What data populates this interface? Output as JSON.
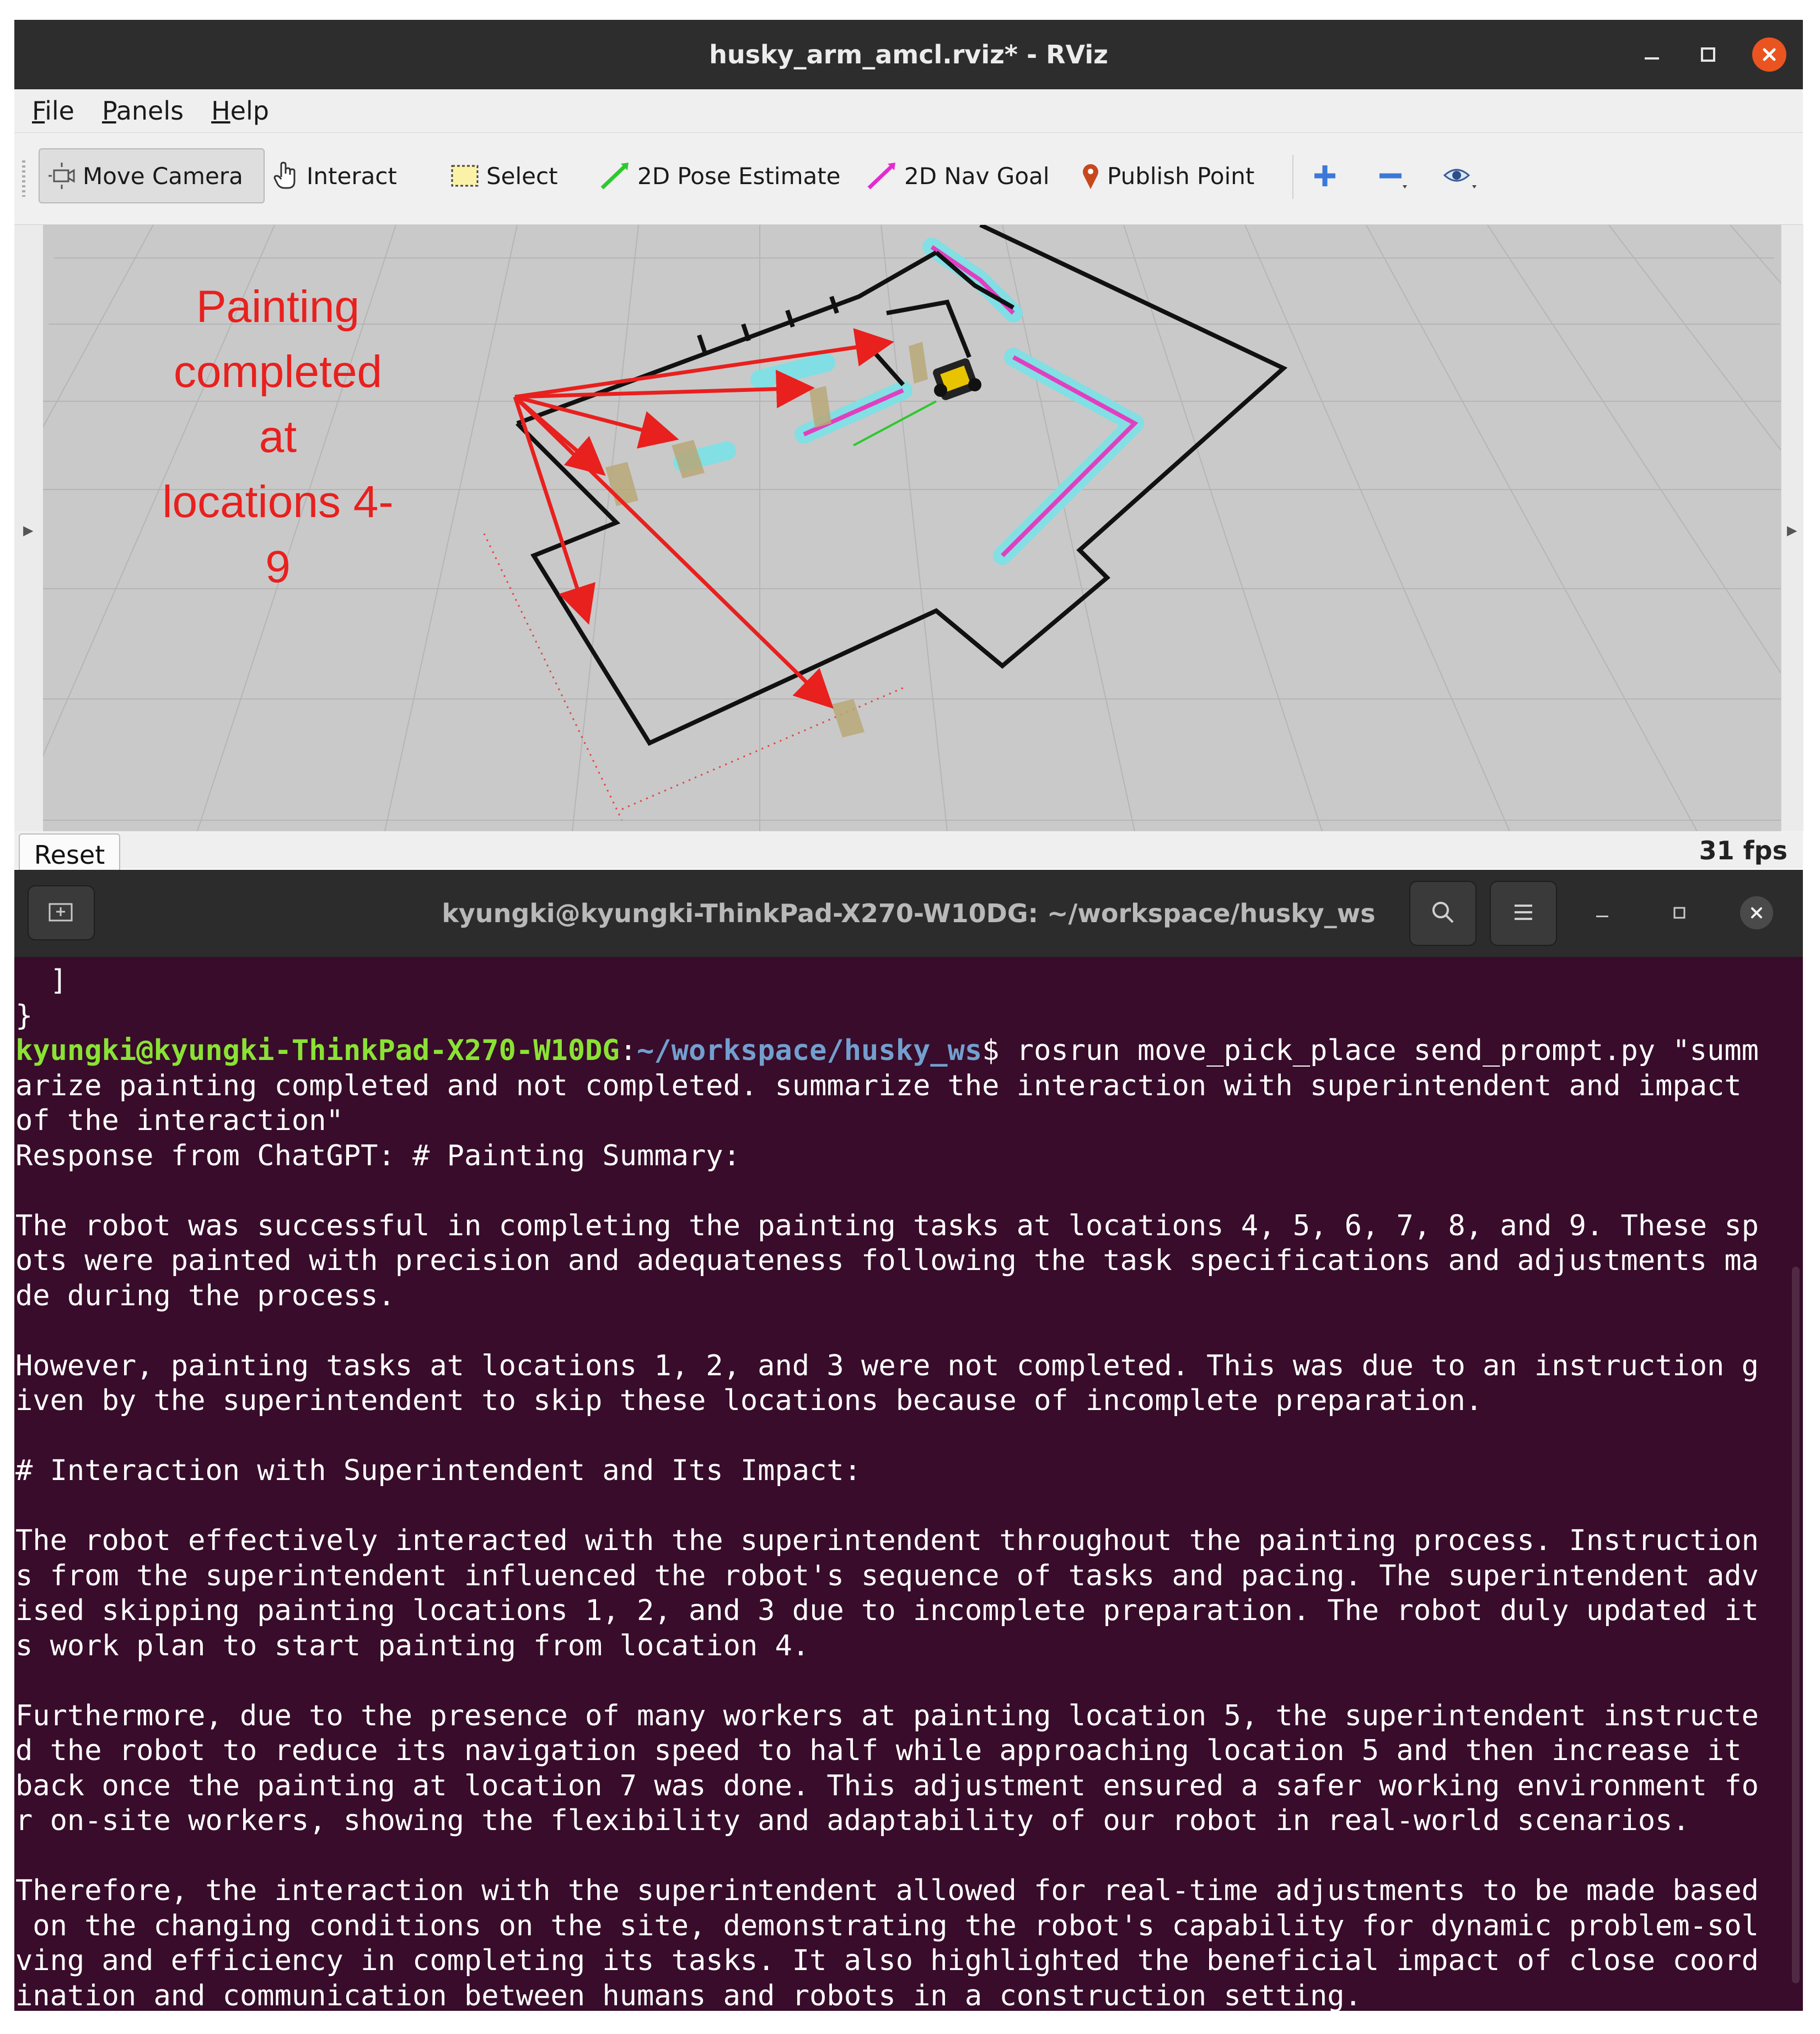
{
  "rviz": {
    "window_title": "husky_arm_amcl.rviz* - RViz",
    "menu": [
      "File",
      "Panels",
      "Help"
    ],
    "toolbar": {
      "move_camera": "Move Camera",
      "interact": "Interact",
      "select": "Select",
      "pose_estimate": "2D Pose Estimate",
      "nav_goal": "2D Nav Goal",
      "publish_point": "Publish Point"
    },
    "annotation_lines": [
      "Painting",
      "completed at",
      "locations 4-9"
    ],
    "reset_label": "Reset",
    "fps": "31 fps",
    "colors": {
      "annotation": "#e8201e",
      "costmap": "#7ee0e6",
      "path": "#e040c0",
      "wall": "#111111",
      "marker": "#b8a878"
    }
  },
  "terminal": {
    "title": "kyungki@kyungki-ThinkPad-X270-W10DG: ~/workspace/husky_ws",
    "prompt_user": "kyungki@kyungki-ThinkPad-X270-W10DG",
    "prompt_path": "~/workspace/husky_ws",
    "prompt_cmd": "$ rosrun move_pick_place send_prompt.py \"summ",
    "lines": [
      "  ]",
      "}",
      "",
      "arize painting completed and not completed. summarize the interaction with superintendent and impact",
      "of the interaction\"",
      "Response from ChatGPT: # Painting Summary:",
      "",
      "The robot was successful in completing the painting tasks at locations 4, 5, 6, 7, 8, and 9. These sp",
      "ots were painted with precision and adequateness following the task specifications and adjustments ma",
      "de during the process.",
      "",
      "However, painting tasks at locations 1, 2, and 3 were not completed. This was due to an instruction g",
      "iven by the superintendent to skip these locations because of incomplete preparation.",
      "",
      "# Interaction with Superintendent and Its Impact:",
      "",
      "The robot effectively interacted with the superintendent throughout the painting process. Instruction",
      "s from the superintendent influenced the robot's sequence of tasks and pacing. The superintendent adv",
      "ised skipping painting locations 1, 2, and 3 due to incomplete preparation. The robot duly updated it",
      "s work plan to start painting from location 4.",
      "",
      "Furthermore, due to the presence of many workers at painting location 5, the superintendent instructe",
      "d the robot to reduce its navigation speed to half while approaching location 5 and then increase it",
      "back once the painting at location 7 was done. This adjustment ensured a safer working environment fo",
      "r on-site workers, showing the flexibility and adaptability of our robot in real-world scenarios.",
      "",
      "Therefore, the interaction with the superintendent allowed for real-time adjustments to be made based",
      " on the changing conditions on the site, demonstrating the robot's capability for dynamic problem-sol",
      "ving and efficiency in completing its tasks. It also highlighted the beneficial impact of close coord",
      "ination and communication between humans and robots in a construction setting."
    ],
    "colors": {
      "background": "#380c2a",
      "user": "#8ae234",
      "path": "#729fcf",
      "text": "#ffffff"
    }
  }
}
